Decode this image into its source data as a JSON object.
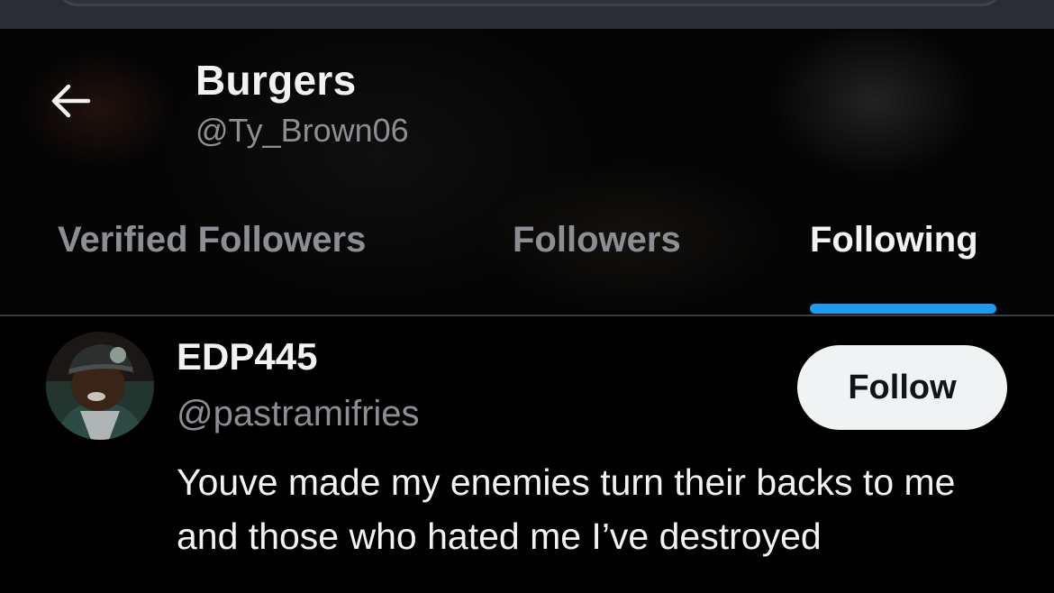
{
  "header": {
    "back_icon": "arrow-left-icon",
    "title": "Burgers",
    "handle": "@Ty_Brown06"
  },
  "tabs": [
    {
      "label": "Verified Followers",
      "active": false
    },
    {
      "label": "Followers",
      "active": false
    },
    {
      "label": "Following",
      "active": true
    }
  ],
  "colors": {
    "accent": "#1d9bf0",
    "background": "#000000",
    "muted_text": "#8b8f94",
    "primary_text": "#f2f2f2",
    "follow_button_bg": "#eff3f4"
  },
  "list": {
    "items": [
      {
        "name": "EDP445",
        "handle": "@pastramifries",
        "follow_label": "Follow",
        "bio": "Youve made my enemies turn their backs to me and those who hated me I’ve destroyed"
      }
    ]
  }
}
